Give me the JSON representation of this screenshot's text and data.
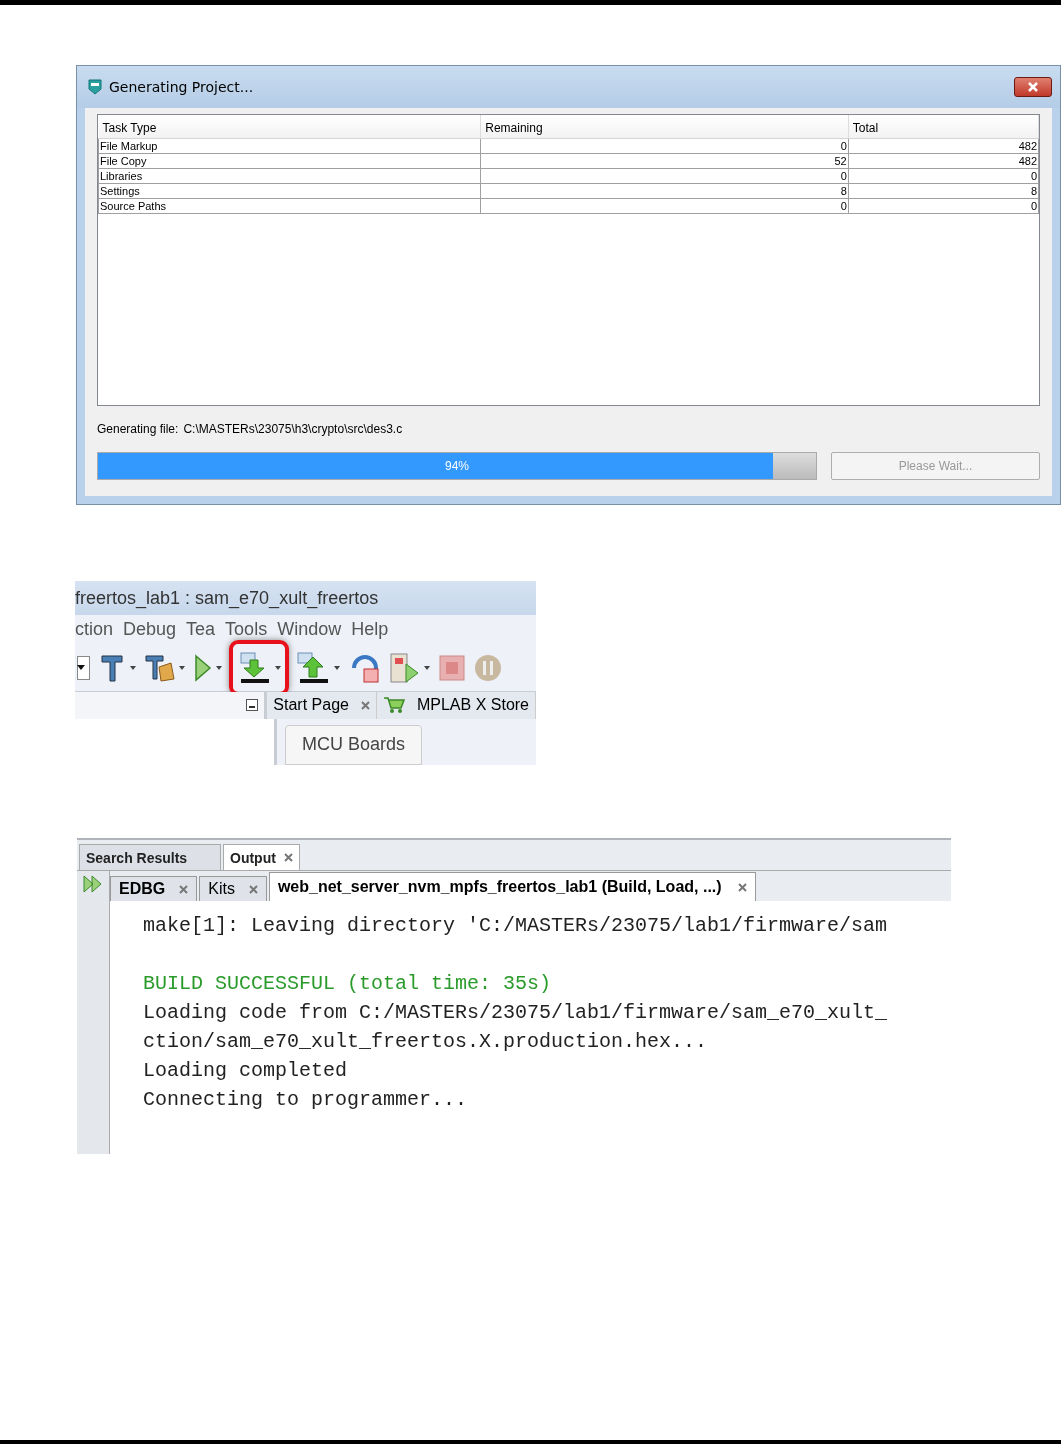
{
  "dialog": {
    "title": "Generating Project...",
    "table": {
      "columns": [
        "Task Type",
        "Remaining",
        "Total"
      ],
      "rows": [
        [
          "File Markup",
          "0",
          "482"
        ],
        [
          "File Copy",
          "52",
          "482"
        ],
        [
          "Libraries",
          "0",
          "0"
        ],
        [
          "Settings",
          "8",
          "8"
        ],
        [
          "Source Paths",
          "0",
          "0"
        ]
      ]
    },
    "status_label": "Generating file:",
    "status_path": "C:\\MASTERs\\23075\\h3\\crypto\\src\\des3.c",
    "progress": {
      "level": 0.94,
      "reading": "94%"
    },
    "button": {
      "label": "Please Wait...",
      "disabled": true
    }
  },
  "ide": {
    "title": "freertos_lab1 : sam_e70_xult_freertos",
    "menu": [
      "ction",
      "Debug",
      "Tea",
      "Tools",
      "Window",
      "Help"
    ],
    "toolbar": [
      {
        "kind": "combo",
        "highlighted": false
      },
      {
        "kind": "build",
        "highlighted": false
      },
      {
        "kind": "clean",
        "highlighted": false
      },
      {
        "kind": "run",
        "highlighted": false
      },
      {
        "kind": "program",
        "highlighted": true
      },
      {
        "kind": "read",
        "highlighted": false
      },
      {
        "kind": "reset",
        "highlighted": false
      },
      {
        "kind": "debug",
        "highlighted": false
      },
      {
        "kind": "stop",
        "highlighted": false
      },
      {
        "kind": "pause",
        "highlighted": false
      }
    ],
    "tabs": [
      {
        "label": "Start Page",
        "kind": "page"
      },
      {
        "label": "MPLAB X Store",
        "kind": "store"
      }
    ],
    "panel_heading": "MCU Boards"
  },
  "output": {
    "top_tabs": [
      {
        "label": "Search Results",
        "selected": false
      },
      {
        "label": "Output",
        "selected": true
      }
    ],
    "tabs": [
      {
        "label": "EDBG",
        "selected": false
      },
      {
        "label": "Kits",
        "selected": false
      },
      {
        "label": "web_net_server_nvm_mpfs_freertos_lab1 (Build, Load, ...)",
        "selected": true
      }
    ],
    "lines": [
      {
        "kind": "normal",
        "text": "make[1]: Leaving directory 'C:/MASTERs/23075/lab1/firmware/sam"
      },
      {
        "kind": "blank"
      },
      {
        "kind": "success",
        "text": "BUILD SUCCESSFUL (total time: 35s)"
      },
      {
        "kind": "normal",
        "text": "Loading code from C:/MASTERs/23075/lab1/firmware/sam_e70_xult_"
      },
      {
        "kind": "normal",
        "text": "ction/sam_e70_xult_freertos.X.production.hex..."
      },
      {
        "kind": "normal",
        "text": "Loading completed"
      },
      {
        "kind": "normal",
        "text": "Connecting to programmer..."
      }
    ]
  }
}
